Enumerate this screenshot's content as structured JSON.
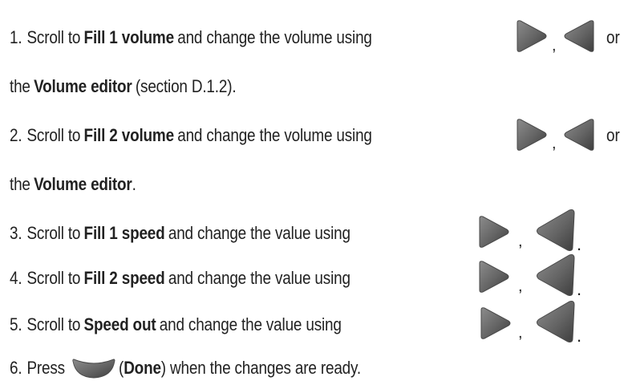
{
  "instructions": [
    {
      "number": "1.",
      "pre": "Scroll to",
      "bold": "Fill 1 volume",
      "post": "and change the volume using",
      "sep": ",",
      "tail": "or"
    },
    {
      "pre": "the",
      "bold": "Volume editor",
      "post": "(section D.1.2)."
    },
    {
      "number": "2.",
      "pre": "Scroll to",
      "bold": "Fill 2 volume",
      "post": "and change the volume using",
      "sep": ",",
      "tail": "or"
    },
    {
      "pre": "the",
      "bold": "Volume editor",
      "post": "."
    },
    {
      "number": "3.",
      "pre": "Scroll to",
      "bold": "Fill 1 speed",
      "post": "and change the value using",
      "sep": ",",
      "end": "."
    },
    {
      "number": "4.",
      "pre": "Scroll to",
      "bold": "Fill 2 speed",
      "post": "and change the value using",
      "sep": ",",
      "end": "."
    },
    {
      "number": "5.",
      "pre": "Scroll to",
      "bold": "Speed out",
      "post": "and change the value using",
      "sep": ",",
      "end": "."
    },
    {
      "number": "6.",
      "pre": "Press",
      "paren_open": "(",
      "bold": "Done",
      "post": ") when the changes are ready."
    }
  ],
  "icons": {
    "right": "right-arrow-key-icon",
    "left": "left-arrow-key-icon",
    "done": "done-key-icon"
  },
  "colors": {
    "text": "#222222",
    "key_fill": "#6b6b6b",
    "key_edge": "#3f3f3f"
  }
}
